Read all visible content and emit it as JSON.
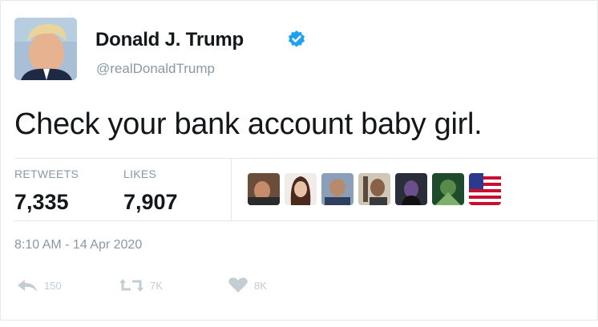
{
  "user": {
    "display_name": "Donald J. Trump",
    "handle": "@realDonaldTrump",
    "verified": true,
    "verified_icon": "verified-badge-icon",
    "accent_color": "#1da1f2"
  },
  "tweet": {
    "text": "Check your bank account baby girl.",
    "timestamp": "8:10 AM - 14 Apr 2020"
  },
  "stats": {
    "retweets_label": "RETWEETS",
    "retweets_value": "7,335",
    "likes_label": "LIKES",
    "likes_value": "7,907"
  },
  "liked_by_avatars": [
    "avatar-1",
    "avatar-2",
    "avatar-3",
    "avatar-4",
    "avatar-5",
    "avatar-6",
    "avatar-7-flag"
  ],
  "actions": {
    "reply_icon": "reply-icon",
    "reply_count": "150",
    "retweet_icon": "retweet-icon",
    "retweet_count": "7K",
    "like_icon": "heart-icon",
    "like_count": "8K"
  }
}
